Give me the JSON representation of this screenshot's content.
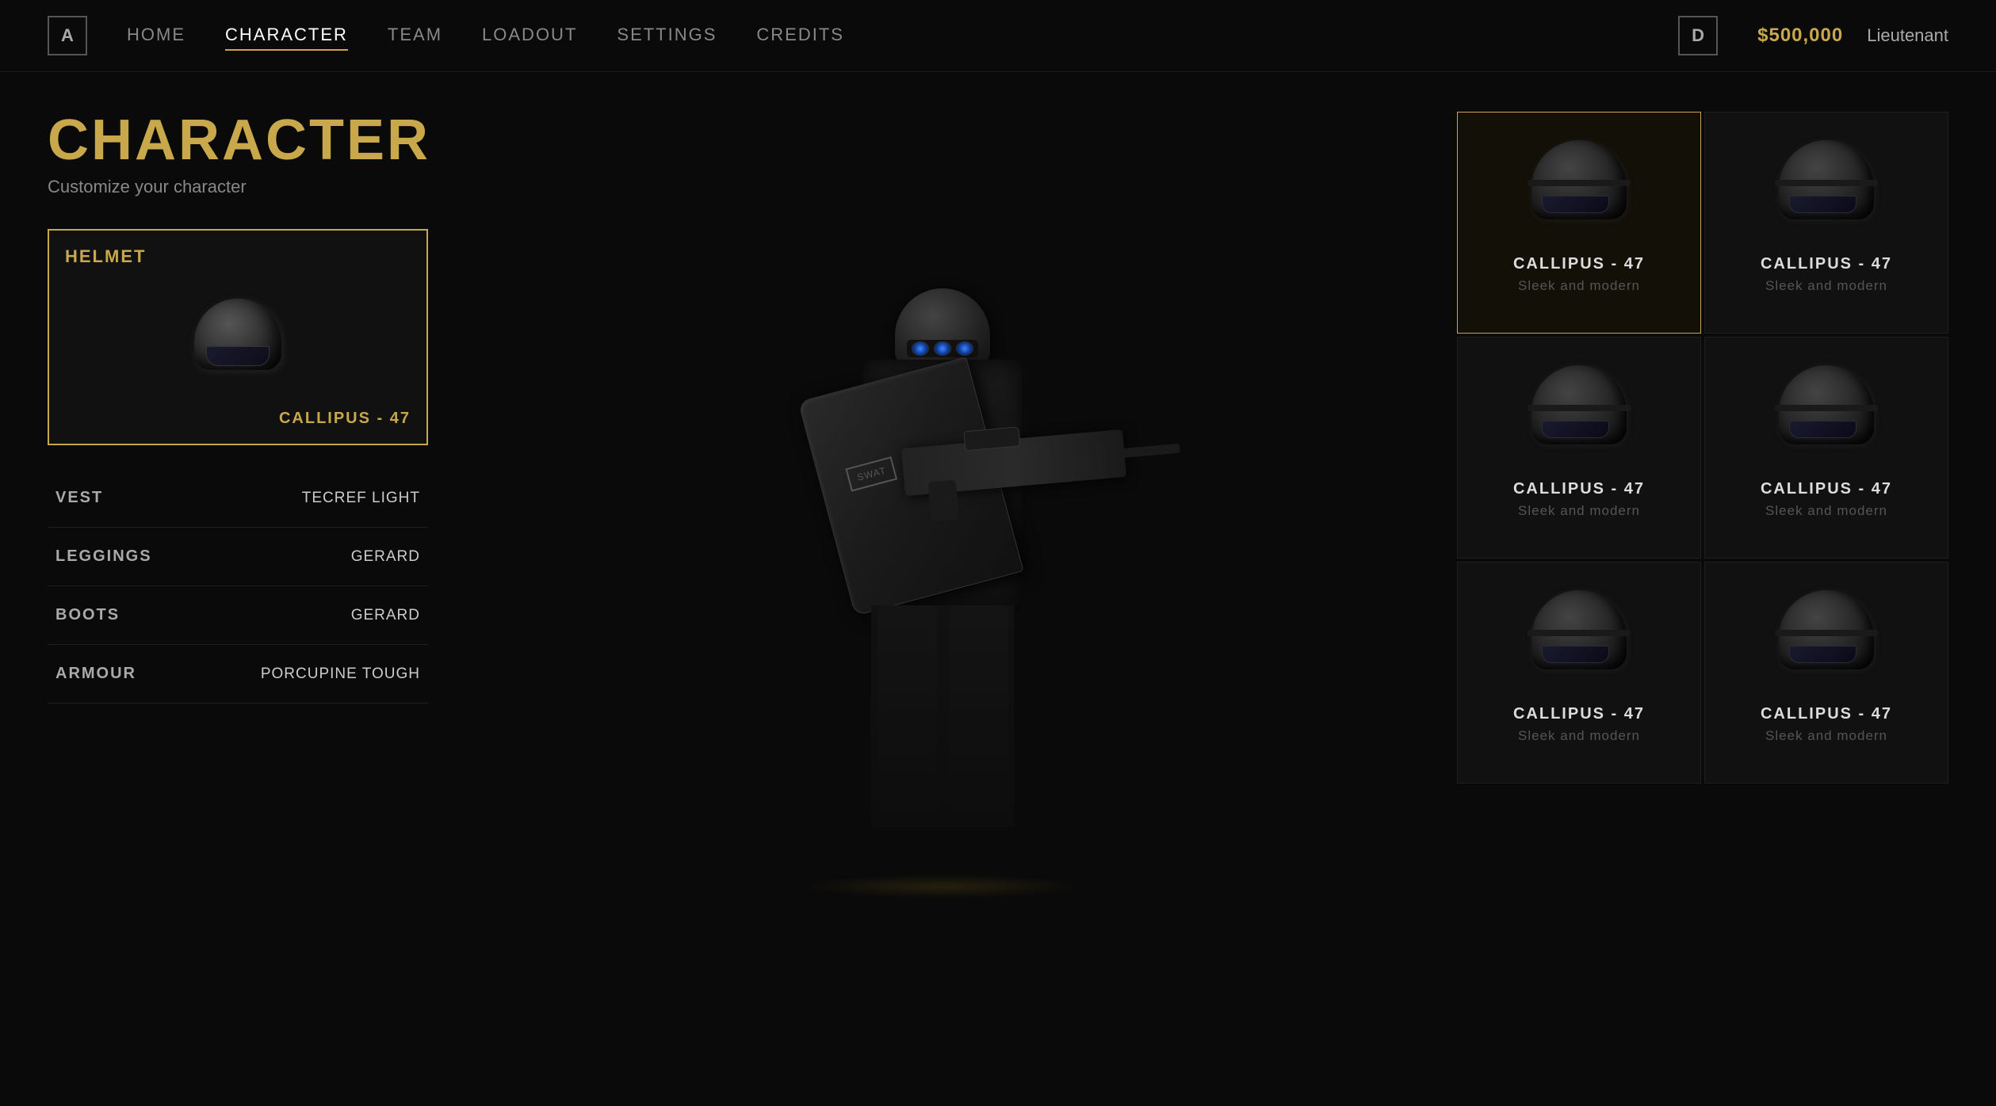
{
  "nav": {
    "icon_a": "A",
    "icon_d": "D",
    "items": [
      {
        "label": "HOME",
        "active": false
      },
      {
        "label": "CHARACTER",
        "active": true
      },
      {
        "label": "TEAM",
        "active": false
      },
      {
        "label": "LOADOUT",
        "active": false
      },
      {
        "label": "SETTINGS",
        "active": false
      },
      {
        "label": "CREDITS",
        "active": false
      }
    ],
    "credits": "$500,000",
    "rank": "Lieutenant"
  },
  "page": {
    "title": "CHARACTER",
    "subtitle": "Customize your character"
  },
  "gear": {
    "helmet_label": "HELMET",
    "helmet_name": "CALLIPUS - 47",
    "items": [
      {
        "label": "VEST",
        "value": "TECREF LIGHT"
      },
      {
        "label": "LEGGINGS",
        "value": "GERARD"
      },
      {
        "label": "BOOTS",
        "value": "GERARD"
      },
      {
        "label": "ARMOUR",
        "value": "PORCUPINE TOUGH"
      }
    ]
  },
  "shield_logo": "SWAT",
  "item_grid": [
    {
      "name": "CALLIPUS - 47",
      "desc": "Sleek and modern",
      "selected": true
    },
    {
      "name": "CALLIPUS - 47",
      "desc": "Sleek and modern",
      "selected": false
    },
    {
      "name": "CALLIPUS - 47",
      "desc": "Sleek and modern",
      "selected": false
    },
    {
      "name": "CALLIPUS - 47",
      "desc": "Sleek and modern",
      "selected": false
    },
    {
      "name": "CALLIPUS - 47",
      "desc": "Sleek and modern",
      "selected": false
    },
    {
      "name": "CALLIPUS - 47",
      "desc": "Sleek and modern",
      "selected": false
    }
  ]
}
